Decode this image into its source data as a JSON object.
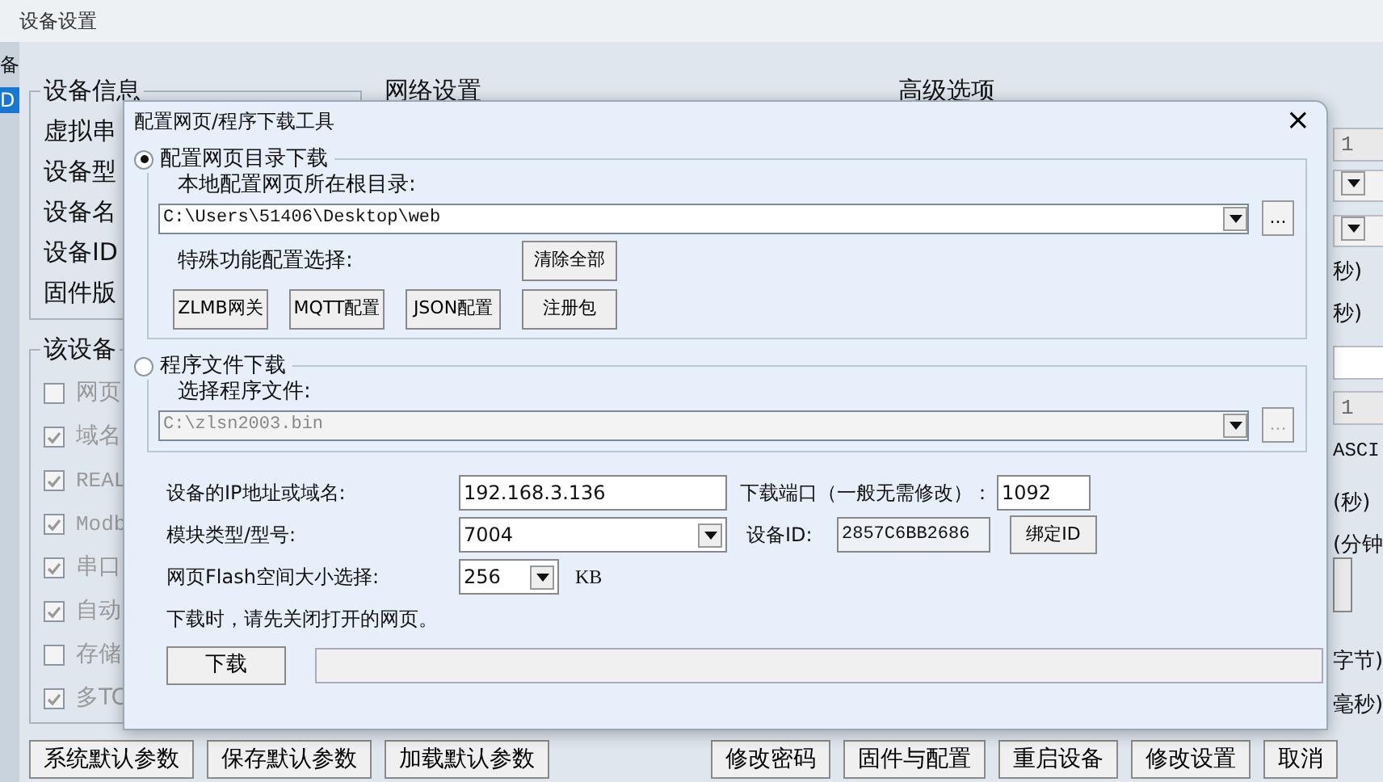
{
  "window": {
    "title": "设备设置"
  },
  "side_list": [
    {
      "text": "备",
      "selected": false
    },
    {
      "text": "D",
      "selected": true
    }
  ],
  "device_info": {
    "title": "设备信息",
    "labels": [
      "虚拟串",
      "设备型",
      "设备名",
      "设备ID",
      "固件版"
    ]
  },
  "features": {
    "title": "该设备",
    "items": [
      {
        "label": "网页",
        "checked": false
      },
      {
        "label": "域名",
        "checked": true
      },
      {
        "label": "REAL",
        "checked": true
      },
      {
        "label": "Modb",
        "checked": true
      },
      {
        "label": "串口",
        "checked": true
      },
      {
        "label": "自动",
        "checked": true
      },
      {
        "label": "存储",
        "checked": false
      },
      {
        "label": "多TC",
        "checked": true
      }
    ]
  },
  "network": {
    "title": "网络设置"
  },
  "advanced": {
    "title": "高级选项",
    "edge_items": [
      {
        "kind": "field",
        "text": "1",
        "disabled": true
      },
      {
        "kind": "combo"
      },
      {
        "kind": "combo"
      },
      {
        "kind": "text",
        "text": "秒)"
      },
      {
        "kind": "text",
        "text": "秒)"
      },
      {
        "kind": "field",
        "disabled": false
      },
      {
        "kind": "field",
        "text": "1",
        "disabled": true
      },
      {
        "kind": "text",
        "text": "ASCI"
      },
      {
        "kind": "text",
        "text": "(秒)"
      },
      {
        "kind": "text",
        "text": "(分钟"
      },
      {
        "kind": "button"
      },
      {
        "kind": "text",
        "text": "字节)"
      },
      {
        "kind": "text",
        "text": "毫秒)"
      }
    ]
  },
  "bottom_buttons": [
    "系统默认参数",
    "保存默认参数",
    "加载默认参数",
    "修改密码",
    "固件与配置",
    "重启设备",
    "修改设置",
    "取消"
  ],
  "dialog": {
    "title": "配置网页/程序下载工具",
    "close": "×",
    "web_group": {
      "label": "配置网页目录下载",
      "selected": true,
      "dir_label": "本地配置网页所在根目录:",
      "path": "C:\\Users\\51406\\Desktop\\web",
      "browse": "...",
      "special_label": "特殊功能配置选择:",
      "clear_button": "清除全部",
      "buttons": [
        "ZLMB网关",
        "MQTT配置",
        "JSON配置",
        "注册包"
      ]
    },
    "program_group": {
      "label": "程序文件下载",
      "selected": false,
      "file_label": "选择程序文件:",
      "path": "C:\\zlsn2003.bin",
      "browse": "...",
      "disabled": true
    },
    "ip_label": "设备的IP地址或域名:",
    "ip": "192.168.3.136",
    "port_label": "下载端口（一般无需修改）：",
    "port": "1092",
    "model_label": "模块类型/型号:",
    "model": "7004",
    "id_label": "设备ID:",
    "device_id": "2857C6BB2686",
    "bind_button": "绑定ID",
    "flash_label": "网页Flash空间大小选择:",
    "flash": "256",
    "flash_unit": "KB",
    "note": "下载时，请先关闭打开的网页。",
    "download_button": "下载",
    "progress": {
      "level": 0
    }
  }
}
